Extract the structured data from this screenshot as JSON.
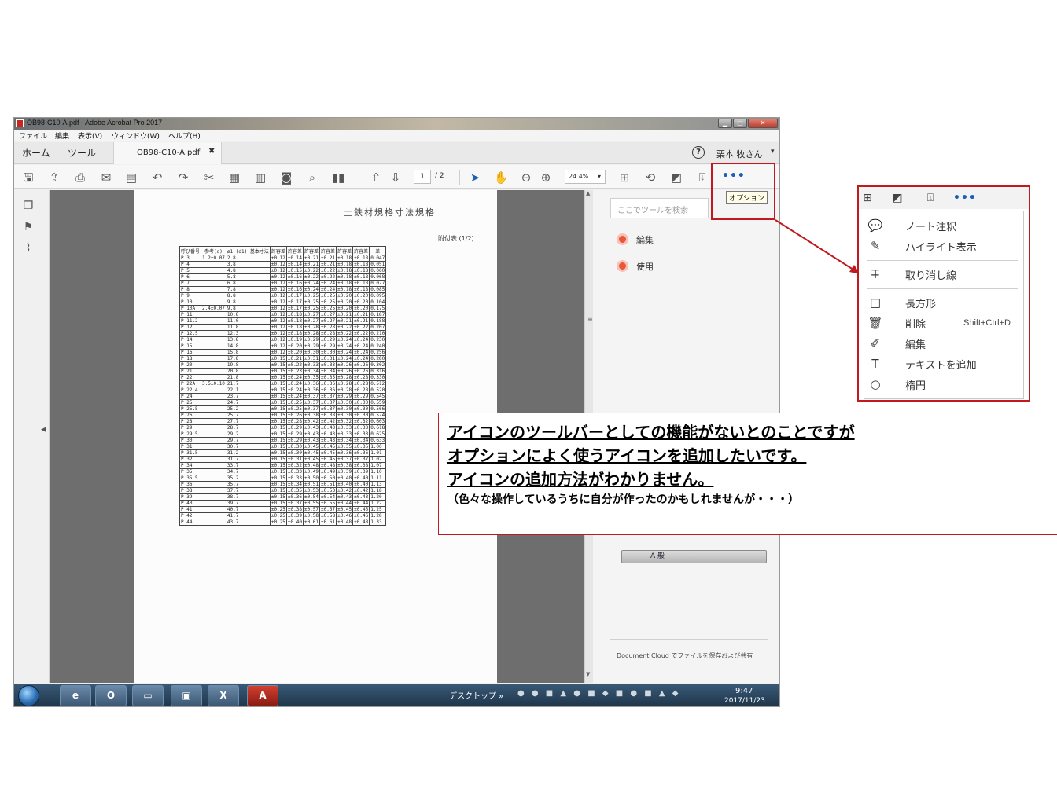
{
  "window": {
    "title": "OB98-C10-A.pdf - Adobe Acrobat Pro 2017",
    "min_glyph": "▁",
    "max_glyph": "□",
    "close_glyph": "✕"
  },
  "menu": [
    "ファイル",
    "編集",
    "表示(V)",
    "ウィンドウ(W)",
    "ヘルプ(H)"
  ],
  "tabs": {
    "home": "ホーム",
    "tools": "ツール",
    "document": "OB98-C10-A.pdf",
    "document_close": "✖",
    "help_glyph": "?",
    "user": "栗本 牧さん",
    "user_caret": "▾"
  },
  "toolbar": {
    "icons": [
      "save-icon",
      "upload-icon",
      "print-icon",
      "email-icon",
      "document-search-icon",
      "undo-icon",
      "redo-icon",
      "scissors-icon",
      "redact-icon",
      "clipboard-icon",
      "snapshot-icon",
      "search-icon",
      "compare-icon",
      "page-up-icon",
      "page-down-icon",
      "select-cursor-icon",
      "hand-icon",
      "zoom-out-icon",
      "zoom-in-icon"
    ],
    "page_current": "1",
    "page_total": "/ 2",
    "zoom": "24.4%",
    "zoom_caret": "▾",
    "more_label": "•••",
    "tooltip": "オプション",
    "accent": "#1a5fb4"
  },
  "document_page": {
    "header": "土鉄材規格寸法規格",
    "page_label": "附付表 (1/2)",
    "table_header": [
      "呼び番号",
      "参考(d)",
      "ø1 (d1) 基本寸法",
      "許容差",
      "許容差",
      "許容差",
      "許容差",
      "許容差",
      "許容差",
      "差"
    ],
    "rows": [
      [
        "P 3",
        "1.2±0.07",
        "2.8",
        "±0.12",
        "±0.14",
        "±0.21",
        "±0.21",
        "±0.18",
        "±0.18",
        "0.047"
      ],
      [
        "P 4",
        "",
        "3.8",
        "±0.12",
        "±0.14",
        "±0.21",
        "±0.21",
        "±0.18",
        "±0.18",
        "0.051"
      ],
      [
        "P 5",
        "",
        "4.8",
        "±0.12",
        "±0.15",
        "±0.22",
        "±0.22",
        "±0.18",
        "±0.18",
        "0.060"
      ],
      [
        "P 6",
        "",
        "5.8",
        "±0.12",
        "±0.16",
        "±0.22",
        "±0.22",
        "±0.18",
        "±0.18",
        "0.068"
      ],
      [
        "P 7",
        "",
        "6.8",
        "±0.12",
        "±0.16",
        "±0.24",
        "±0.24",
        "±0.18",
        "±0.18",
        "0.077"
      ],
      [
        "P 8",
        "",
        "7.8",
        "±0.12",
        "±0.16",
        "±0.24",
        "±0.24",
        "±0.18",
        "±0.18",
        "0.085"
      ],
      [
        "P 9",
        "",
        "8.8",
        "±0.12",
        "±0.17",
        "±0.25",
        "±0.25",
        "±0.20",
        "±0.20",
        "0.095"
      ],
      [
        "P 10",
        "",
        "9.8",
        "±0.12",
        "±0.17",
        "±0.25",
        "±0.25",
        "±0.20",
        "±0.20",
        "0.104"
      ],
      [
        "P 10A",
        "2.4±0.07",
        "9.8",
        "±0.12",
        "±0.17",
        "±0.25",
        "±0.25",
        "±0.20",
        "±0.20",
        "0.175"
      ],
      [
        "P 11",
        "",
        "10.8",
        "±0.12",
        "±0.18",
        "±0.27",
        "±0.27",
        "±0.21",
        "±0.21",
        "0.187"
      ],
      [
        "P 11.2",
        "",
        "11.0",
        "±0.12",
        "±0.18",
        "±0.27",
        "±0.27",
        "±0.21",
        "±0.21",
        "0.188"
      ],
      [
        "P 12",
        "",
        "11.8",
        "±0.12",
        "±0.18",
        "±0.28",
        "±0.28",
        "±0.22",
        "±0.22",
        "0.207"
      ],
      [
        "P 12.5",
        "",
        "12.3",
        "±0.12",
        "±0.18",
        "±0.28",
        "±0.28",
        "±0.22",
        "±0.22",
        "0.210"
      ],
      [
        "P 14",
        "",
        "13.8",
        "±0.12",
        "±0.19",
        "±0.29",
        "±0.29",
        "±0.24",
        "±0.24",
        "0.230"
      ],
      [
        "P 15",
        "",
        "14.8",
        "±0.12",
        "±0.20",
        "±0.29",
        "±0.29",
        "±0.24",
        "±0.24",
        "0.240"
      ],
      [
        "P 16",
        "",
        "15.8",
        "±0.12",
        "±0.20",
        "±0.30",
        "±0.30",
        "±0.24",
        "±0.24",
        "0.256"
      ],
      [
        "P 18",
        "",
        "17.8",
        "±0.15",
        "±0.21",
        "±0.31",
        "±0.31",
        "±0.24",
        "±0.24",
        "0.280"
      ],
      [
        "P 20",
        "",
        "19.8",
        "±0.15",
        "±0.22",
        "±0.33",
        "±0.33",
        "±0.26",
        "±0.26",
        "0.302"
      ],
      [
        "P 21",
        "",
        "20.8",
        "±0.15",
        "±0.23",
        "±0.34",
        "±0.34",
        "±0.26",
        "±0.26",
        "0.316"
      ],
      [
        "P 22",
        "",
        "21.8",
        "±0.15",
        "±0.24",
        "±0.35",
        "±0.35",
        "±0.28",
        "±0.28",
        "0.330"
      ],
      [
        "P 22A",
        "3.5±0.10",
        "21.7",
        "±0.15",
        "±0.24",
        "±0.36",
        "±0.36",
        "±0.28",
        "±0.28",
        "0.512"
      ],
      [
        "P 22.4",
        "",
        "22.1",
        "±0.15",
        "±0.24",
        "±0.36",
        "±0.36",
        "±0.28",
        "±0.28",
        "0.520"
      ],
      [
        "P 24",
        "",
        "23.7",
        "±0.15",
        "±0.24",
        "±0.37",
        "±0.37",
        "±0.29",
        "±0.29",
        "0.545"
      ],
      [
        "P 25",
        "",
        "24.7",
        "±0.15",
        "±0.25",
        "±0.37",
        "±0.37",
        "±0.30",
        "±0.30",
        "0.559"
      ],
      [
        "P 25.5",
        "",
        "25.2",
        "±0.15",
        "±0.25",
        "±0.37",
        "±0.37",
        "±0.30",
        "±0.30",
        "0.566"
      ],
      [
        "P 26",
        "",
        "25.7",
        "±0.15",
        "±0.26",
        "±0.38",
        "±0.38",
        "±0.30",
        "±0.30",
        "0.574"
      ],
      [
        "P 28",
        "",
        "27.7",
        "±0.15",
        "±0.28",
        "±0.42",
        "±0.42",
        "±0.32",
        "±0.32",
        "0.603"
      ],
      [
        "P 29",
        "",
        "28.7",
        "±0.15",
        "±0.29",
        "±0.43",
        "±0.43",
        "±0.33",
        "±0.33",
        "0.618"
      ],
      [
        "P 29.5",
        "",
        "29.2",
        "±0.15",
        "±0.29",
        "±0.43",
        "±0.43",
        "±0.33",
        "±0.33",
        "0.625"
      ],
      [
        "P 30",
        "",
        "29.7",
        "±0.15",
        "±0.29",
        "±0.43",
        "±0.43",
        "±0.34",
        "±0.34",
        "0.633"
      ],
      [
        "P 31",
        "",
        "30.7",
        "±0.15",
        "±0.30",
        "±0.45",
        "±0.45",
        "±0.35",
        "±0.35",
        "1.00"
      ],
      [
        "P 31.5",
        "",
        "31.2",
        "±0.15",
        "±0.30",
        "±0.45",
        "±0.45",
        "±0.36",
        "±0.36",
        "1.01"
      ],
      [
        "P 32",
        "",
        "31.7",
        "±0.15",
        "±0.31",
        "±0.45",
        "±0.45",
        "±0.37",
        "±0.37",
        "1.02"
      ],
      [
        "P 34",
        "",
        "33.7",
        "±0.15",
        "±0.32",
        "±0.48",
        "±0.48",
        "±0.38",
        "±0.38",
        "1.07"
      ],
      [
        "P 35",
        "",
        "34.7",
        "±0.15",
        "±0.33",
        "±0.49",
        "±0.49",
        "±0.39",
        "±0.39",
        "1.10"
      ],
      [
        "P 35.5",
        "",
        "35.2",
        "±0.15",
        "±0.33",
        "±0.50",
        "±0.50",
        "±0.40",
        "±0.40",
        "1.11"
      ],
      [
        "P 36",
        "",
        "35.7",
        "±0.15",
        "±0.34",
        "±0.51",
        "±0.51",
        "±0.40",
        "±0.40",
        "1.13"
      ],
      [
        "P 38",
        "",
        "37.7",
        "±0.15",
        "±0.35",
        "±0.53",
        "±0.53",
        "±0.42",
        "±0.42",
        "1.18"
      ],
      [
        "P 39",
        "",
        "38.7",
        "±0.15",
        "±0.36",
        "±0.54",
        "±0.54",
        "±0.43",
        "±0.43",
        "1.20"
      ],
      [
        "P 40",
        "",
        "39.7",
        "±0.15",
        "±0.37",
        "±0.55",
        "±0.55",
        "±0.44",
        "±0.44",
        "1.22"
      ],
      [
        "P 41",
        "",
        "40.7",
        "±0.25",
        "±0.38",
        "±0.57",
        "±0.57",
        "±0.45",
        "±0.45",
        "1.25"
      ],
      [
        "P 42",
        "",
        "41.7",
        "±0.25",
        "±0.39",
        "±0.58",
        "±0.58",
        "±0.46",
        "±0.46",
        "1.28"
      ],
      [
        "P 44",
        "",
        "43.7",
        "±0.25",
        "±0.40",
        "±0.61",
        "±0.61",
        "±0.48",
        "±0.48",
        "1.33"
      ]
    ]
  },
  "left_rail": {
    "icons": [
      "pages-icon",
      "bookmark-icon",
      "attachment-icon"
    ],
    "collapse_glyph": "◀"
  },
  "right_pane": {
    "search_placeholder": "ここでツールを検索",
    "items": [
      "編集",
      "使用"
    ],
    "cloud_text": "Document Cloud でファイルを保存および共有",
    "ime_text": "A 般"
  },
  "scrollbar": {
    "up": "▲",
    "down": "▼",
    "grip": "≡"
  },
  "taskbar": {
    "apps": [
      "ie-icon",
      "outlook-icon",
      "explorer-folder-icon",
      "control-panel-icon",
      "excel-icon",
      "acrobat-icon"
    ],
    "desktop_label": "デスクトップ »",
    "time": "9:47",
    "date": "2017/11/23"
  },
  "options_menu": {
    "more_label": "•••",
    "items": [
      "ノート注釈",
      "ハイライト表示",
      "取り消し線",
      "長方形",
      "削除",
      "編集",
      "テキストを追加",
      "楕円"
    ],
    "shortcut_delete": "Shift+Ctrl+D"
  },
  "callout": {
    "line1": "アイコンのツールバーとしての機能がないとのことですが",
    "line2": "オプションによく使うアイコンを追加したいです。",
    "line3": "アイコンの追加方法がわかりません。",
    "note": "（色々な操作しているうちに自分が作ったのかもしれませんが・・・）"
  },
  "colors": {
    "annotation_red": "#c0191f",
    "accent_blue": "#1a5fb4",
    "tool_orange": "#e8563d",
    "viewer_gray": "#6e6e6e"
  }
}
